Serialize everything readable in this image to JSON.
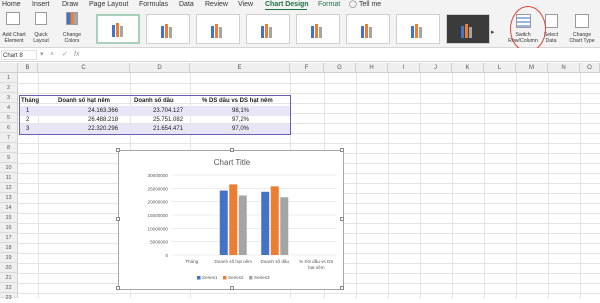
{
  "ribbon_tabs": [
    "Home",
    "Insert",
    "Draw",
    "Page Layout",
    "Formulas",
    "Data",
    "Review",
    "View",
    "Chart Design",
    "Format",
    "Tell me"
  ],
  "active_tab": "Chart Design",
  "ribbon_buttons": {
    "add_chart_element": "Add Chart Element",
    "quick_layout": "Quick Layout",
    "change_colors": "Change Colors",
    "switch_row_column": "Switch Row/Column",
    "select_data": "Select Data",
    "change_chart_type": "Change Chart Type"
  },
  "name_box": "Chart 8",
  "formula_symbols": {
    "cancel": "×",
    "enter": "✓",
    "fx": "fx"
  },
  "columns": [
    "B",
    "C",
    "D",
    "E",
    "F",
    "G",
    "H",
    "I",
    "J",
    "K",
    "L",
    "M",
    "N",
    "O"
  ],
  "rows": [
    "1",
    "2",
    "3",
    "4",
    "5",
    "6",
    "7",
    "8",
    "9",
    "10",
    "11",
    "12",
    "13",
    "14",
    "15",
    "16",
    "17",
    "18",
    "19",
    "20",
    "21",
    "22",
    "23"
  ],
  "table": {
    "headers": [
      "Tháng",
      "Doanh số hạt nêm",
      "Doanh số dầu",
      "% DS dầu vs DS hạt nêm"
    ],
    "rows": [
      [
        "1",
        "24.163.366",
        "23.704.127",
        "98,1%"
      ],
      [
        "2",
        "26.488.218",
        "25.751.082",
        "97,2%"
      ],
      [
        "3",
        "22.320.296",
        "21.654.471",
        "97,0%"
      ]
    ]
  },
  "chart_data": {
    "type": "bar",
    "title": "Chart Title",
    "categories": [
      "Tháng",
      "Doanh số hạt nêm",
      "Doanh số dầu",
      "% DS dầu vs DS hạt nêm"
    ],
    "series": [
      {
        "name": "Series1",
        "values": [
          1,
          24163366,
          23704127,
          0.981
        ]
      },
      {
        "name": "Series2",
        "values": [
          2,
          26488218,
          25751082,
          0.972
        ]
      },
      {
        "name": "Series3",
        "values": [
          3,
          22320296,
          21654471,
          0.97
        ]
      }
    ],
    "y_ticks": [
      "0",
      "5000000",
      "10000000",
      "15000000",
      "20000000",
      "25000000",
      "30000000"
    ],
    "ylim": [
      0,
      30000000
    ],
    "legend": "bottom",
    "colors": [
      "#4472c4",
      "#ed7d31",
      "#a5a5a5"
    ]
  },
  "colors": {
    "accent": "#1e7145",
    "highlight_circle": "#d9463c",
    "table_border": "#6a5fb5",
    "band": "#e8e6f6"
  }
}
